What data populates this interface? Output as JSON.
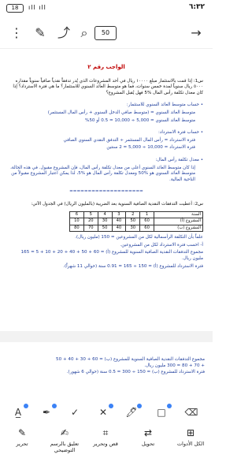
{
  "status_bar": {
    "time": "٦:٣٢",
    "battery": "18",
    "extra": "",
    "signal": "ıll ıll"
  },
  "toolbar": {
    "page_count": "50",
    "back_icon": "arrow-right-icon",
    "pages_icon": "pages-icon"
  },
  "document": {
    "title": "الواجب رقم ٢",
    "q1": "س1: إذا قمت بالاستثمار مبلغ ١٠٠٠٠ ريال في أحد المشروعات الذي يُدر تدفقاً نقدياً صافياً سنوياً مقداره ٥٠٠٠ ريال سنوياً لمدة خمس سنوات، فما هو متوسط العائد السنوي للاستثمار؟ ما هي فترة الاسترداد؟ إذا كان معدل تكلفة رأس المال %5 فهل يُقبل المشروع؟",
    "a1_head": "حساب متوسط العائد السنوي للاستثمار:",
    "a1_l1": "متوسط العائد السنوي = (متوسط صافي الدخل السنوي + رأس المال المستثمر)",
    "a1_l2": "متوسط العائد السنوي = 5,000 ÷ 10,000 = 0.5 أو 50%",
    "a2_head": "حساب فترة الاسترداد:",
    "a2_l1": "فترة الاسترداد = رأس المال المستثمر ÷ التدفق النقدي السنوي الصافي",
    "a2_l2": "فترة الاسترداد = 10,000 ÷ 5,000 = 2 سنتين",
    "a3_head": "معدل تكلفة رأس المال:",
    "a3_l1": "إذا كان متوسط العائد السنوي أعلى من معدل تكلفة رأس المال، فإن المشروع مقبول. في هذه الحالة، متوسط العائد السنوي هو %50 ومعدل تكلفة رأس المال هو %5، لذا يمكن اعتبار المشروع مقبولاً من الناحية المالية.",
    "separator": "====================",
    "q2": "س2: أعطيت التدفقات النقدية الصافية السنوية بعد الضريبة (بالمليون الريال) في الجدول الآتي:",
    "table_headers": [
      "السنة",
      "1",
      "2",
      "3",
      "4",
      "5",
      "6"
    ],
    "table_rows": [
      [
        "المشروع (أ)",
        "60",
        "50",
        "40",
        "30",
        "20",
        "10"
      ],
      [
        "المشروع (ب)",
        "60",
        "30",
        "40",
        "50",
        "70",
        "80"
      ]
    ],
    "q2_note": "علماً بأن التكلفة الرأسمالية لكل من المشروعين = 150 (مليون ريال).",
    "q2_task": "أ- احسب فترة الاسترداد لكل من المشروعين.",
    "q2_calc1": "مجموع التدفقات النقدية الصافية السنوية للمشروع (أ) = 60 + 50 + 40 + 20 + 10 + 5 = 165 مليون ريال.",
    "q2_calc2": "فترة الاسترداد للمشروع (أ) = 150 ÷ 165 = 0.91 سنة (حوالي 11 شهراً)."
  },
  "document_page2": {
    "l1": "مجموع التدفقات النقدية الصافية السنوية للمشروع (ب) = 60 + 30 + 40 + 50",
    "l2": "+ 70 + 80 = 300 مليون ريال.",
    "l3": "فترة الاسترداد للمشروع (ب) = 150 ÷ 300 = 0.5 سنة (حوالي 6 شهور)."
  },
  "tools": [
    "text-box-icon",
    "pen-icon",
    "checkmark-icon",
    "cross-icon",
    "highlighter-icon",
    "rectangle-icon",
    "erase-icon"
  ],
  "nav": [
    {
      "label": "الكل الأدوات",
      "icon": "tools-icon"
    },
    {
      "label": "تحويل",
      "icon": "convert-icon"
    },
    {
      "label": "قص وتحرير",
      "icon": "crop-icon"
    },
    {
      "label": "تعليق بالرسم التوضيحي",
      "icon": "annotate-icon"
    },
    {
      "label": "تحرير",
      "icon": "edit-icon"
    }
  ],
  "colors": {
    "title": "#c00000",
    "answer": "#1f3e9c",
    "accent": "#3b82f6"
  }
}
